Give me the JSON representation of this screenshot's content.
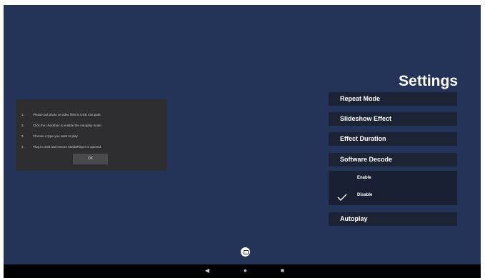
{
  "settings": {
    "title": "Settings",
    "items": [
      {
        "label": "Repeat Mode"
      },
      {
        "label": "Slideshow Effect"
      },
      {
        "label": "Effect Duration"
      },
      {
        "label": "Software Decode"
      },
      {
        "label": "Autoplay"
      }
    ],
    "software_decode_options": [
      {
        "label": "Enable",
        "selected": false
      },
      {
        "label": "Disable",
        "selected": true
      }
    ]
  },
  "dialog": {
    "lines": [
      {
        "num": "1.",
        "text": "Please put photo or video files in USB root path."
      },
      {
        "num": "2.",
        "text": "Click the checkbox to enable the Autoplay mode."
      },
      {
        "num": "3.",
        "text": "Choose a type you want to play."
      },
      {
        "num": "4.",
        "text": "Plug in USB and ensure MediaPlayer is opened."
      }
    ],
    "ok_label": "OK"
  },
  "navbar": {
    "back_glyph": "◀",
    "home_glyph": "●",
    "recents_glyph": "■"
  },
  "colors": {
    "background": "#243458",
    "panel": "#1c2334",
    "dialog": "#2e2e30",
    "navbar": "#000000"
  },
  "icons": [
    "check-icon",
    "home-fab-icon",
    "back-icon",
    "home-icon",
    "recents-icon"
  ]
}
